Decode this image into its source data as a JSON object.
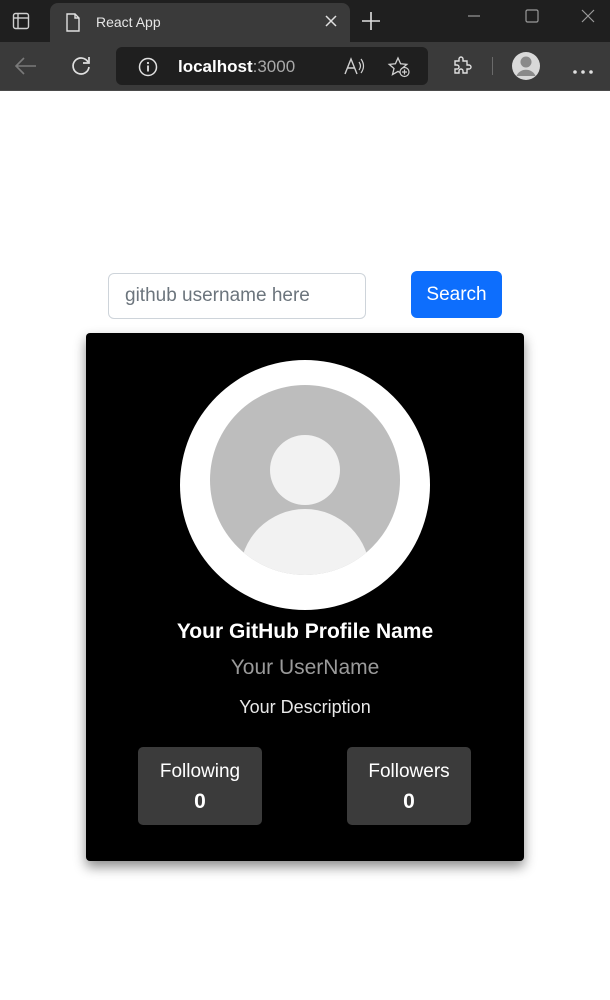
{
  "browser": {
    "tab_title": "React App",
    "url_host": "localhost",
    "url_port": ":3000"
  },
  "search": {
    "placeholder": "github username here",
    "value": "",
    "button_label": "Search"
  },
  "profile": {
    "name": "Your GitHub Profile Name",
    "username": "Your UserName",
    "description": "Your Description",
    "stats": [
      {
        "label": "Following",
        "value": "0"
      },
      {
        "label": "Followers",
        "value": "0"
      }
    ]
  },
  "colors": {
    "accent": "#0d6efd",
    "card_background": "#000000",
    "stat_background": "#3b3b3b"
  }
}
